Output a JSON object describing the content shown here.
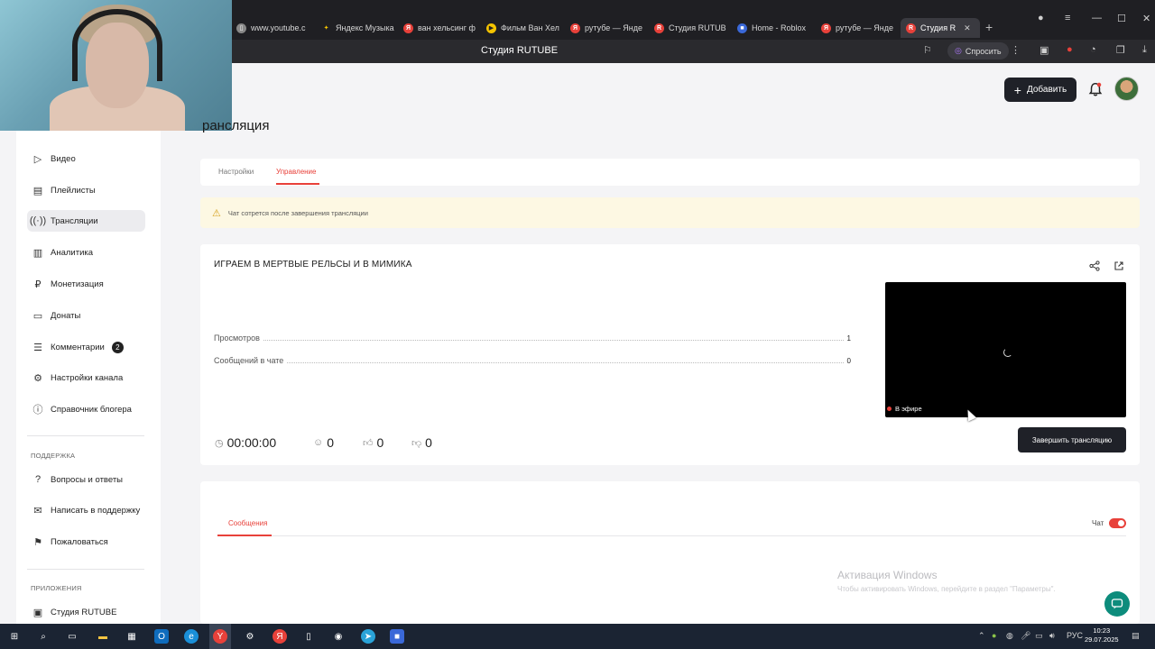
{
  "browser": {
    "tabs": [
      {
        "label": "www.youtube.c",
        "icon": "page-icon",
        "color": "#888888"
      },
      {
        "label": "Яндекс Музыка",
        "icon": "star-icon",
        "color": "#f5c400"
      },
      {
        "label": "ван хельсинг ф",
        "icon": "yandex-icon",
        "color": "#e8413a"
      },
      {
        "label": "Фильм Ван Хел",
        "icon": "play-icon",
        "color": "#f5c400"
      },
      {
        "label": "рутубе — Янде",
        "icon": "yandex-icon",
        "color": "#e8413a"
      },
      {
        "label": "Студия RUTUB",
        "icon": "rutube-icon",
        "color": "#e8413a"
      },
      {
        "label": "Home - Roblox",
        "icon": "roblox-icon",
        "color": "#3a68d8"
      },
      {
        "label": "рутубе — Янде",
        "icon": "yandex-icon",
        "color": "#e8413a"
      },
      {
        "label": "Студия R",
        "icon": "rutube-icon",
        "color": "#e8413a"
      }
    ],
    "page_title": "Студия RUTUBE",
    "ask_label": "Спросить"
  },
  "header": {
    "add_label": "Добавить"
  },
  "sidebar": {
    "items": [
      {
        "label": "Видео",
        "icon": "video-icon"
      },
      {
        "label": "Плейлисты",
        "icon": "playlist-icon"
      },
      {
        "label": "Трансляции",
        "icon": "broadcast-icon"
      },
      {
        "label": "Аналитика",
        "icon": "analytics-icon"
      },
      {
        "label": "Монетизация",
        "icon": "monetization-icon"
      },
      {
        "label": "Донаты",
        "icon": "donate-icon"
      },
      {
        "label": "Комментарии",
        "icon": "comments-icon",
        "badge": "2"
      },
      {
        "label": "Настройки канала",
        "icon": "gear-icon"
      },
      {
        "label": "Справочник блогера",
        "icon": "info-icon"
      }
    ],
    "support_heading": "ПОДДЕРЖКА",
    "support_items": [
      {
        "label": "Вопросы и ответы",
        "icon": "question-icon"
      },
      {
        "label": "Написать в поддержку",
        "icon": "mail-icon"
      },
      {
        "label": "Пожаловаться",
        "icon": "flag-icon"
      }
    ],
    "apps_heading": "ПРИЛОЖЕНИЯ",
    "apps_items": [
      {
        "label": "Студия RUTUBE",
        "icon": "studio-icon"
      }
    ]
  },
  "main": {
    "title": "рансляция",
    "tabs": [
      {
        "label": "Настройки"
      },
      {
        "label": "Управление"
      }
    ],
    "warning": "Чат сотрется после завершения трансляции",
    "stream": {
      "title": "ИГРАЕМ В МЕРТВЫЕ РЕЛЬСЫ И В МИМИКА",
      "stats": [
        {
          "label": "Просмотров",
          "value": "1"
        },
        {
          "label": "Сообщений в чате",
          "value": "0"
        }
      ],
      "live_label": "В эфире",
      "duration": "00:00:00",
      "viewers": "0",
      "likes": "0",
      "dislikes": "0",
      "end_label": "Завершить трансляцию"
    },
    "chat": {
      "tab_label": "Сообщения",
      "toggle_label": "Чат",
      "enabled": true
    }
  },
  "windows": {
    "activate_title": "Активация Windows",
    "activate_sub": "Чтобы активировать Windows, перейдите в раздел \"Параметры\".",
    "lang": "РУС",
    "time": "10:23",
    "date": "29.07.2025"
  },
  "colors": {
    "accent": "#e8413a",
    "dark_button": "#1f2128",
    "warning_bg": "#fdf8e3"
  }
}
